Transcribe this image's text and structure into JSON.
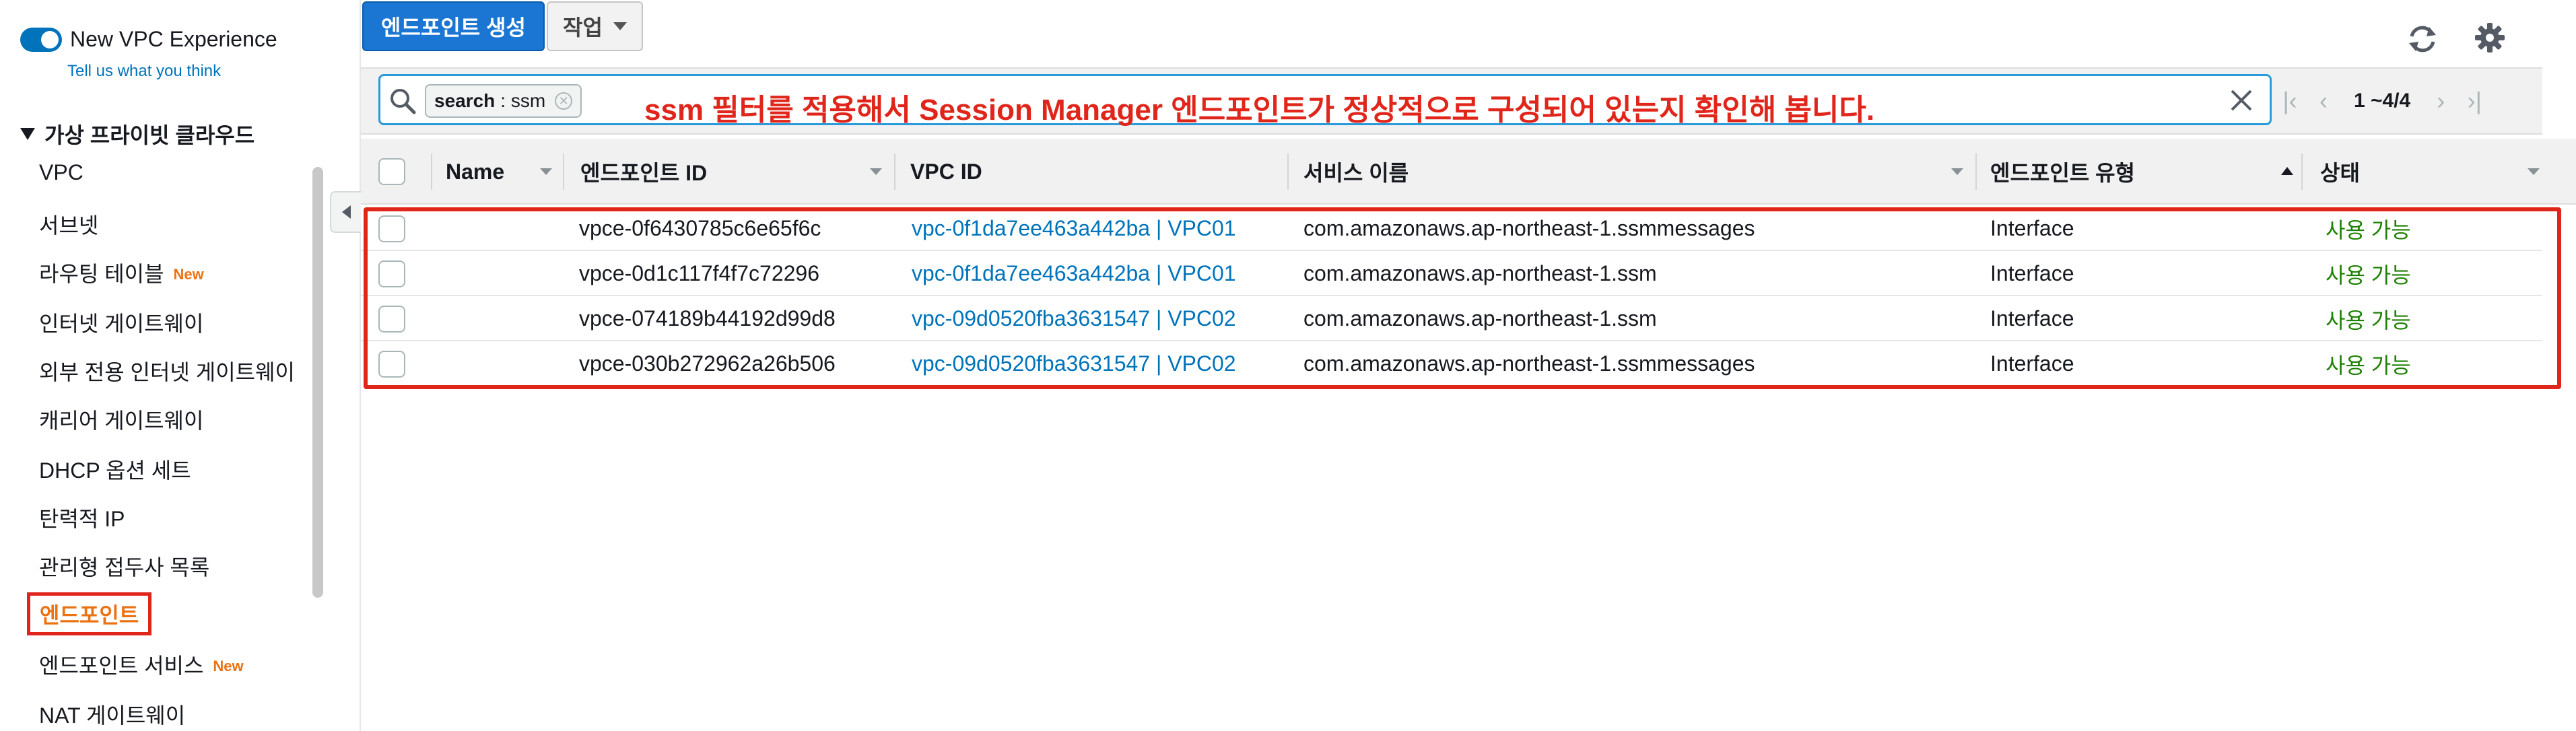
{
  "sidebar": {
    "toggle_label": "New VPC Experience",
    "feedback_link": "Tell us what you think",
    "section_title": "가상 프라이빗 클라우드",
    "items": [
      {
        "label": "VPC",
        "badge": ""
      },
      {
        "label": "서브넷",
        "badge": ""
      },
      {
        "label": "라우팅 테이블",
        "badge": "New"
      },
      {
        "label": "인터넷 게이트웨이",
        "badge": ""
      },
      {
        "label": "외부 전용 인터넷 게이트웨이",
        "badge": ""
      },
      {
        "label": "캐리어 게이트웨이",
        "badge": ""
      },
      {
        "label": "DHCP 옵션 세트",
        "badge": ""
      },
      {
        "label": "탄력적 IP",
        "badge": ""
      },
      {
        "label": "관리형 접두사 목록",
        "badge": ""
      },
      {
        "label": "엔드포인트",
        "badge": ""
      },
      {
        "label": "엔드포인트 서비스",
        "badge": "New"
      },
      {
        "label": "NAT 게이트웨이",
        "badge": ""
      }
    ],
    "active_item": "엔드포인트"
  },
  "toolbar": {
    "create_label": "엔드포인트 생성",
    "actions_label": "작업"
  },
  "filter": {
    "token_key": "search",
    "token_value": ": ssm",
    "annotation": "ssm 필터를 적용해서 Session Manager 엔드포인트가 정상적으로 구성되어 있는지 확인해 봅니다."
  },
  "pagination": {
    "range": "1 ~4/4"
  },
  "table": {
    "columns": {
      "name": "Name",
      "endpoint_id": "엔드포인트 ID",
      "vpc_id": "VPC ID",
      "service_name": "서비스 이름",
      "endpoint_type": "엔드포인트 유형",
      "status": "상태"
    },
    "rows": [
      {
        "name": "",
        "endpoint_id": "vpce-0f6430785c6e65f6c",
        "vpc_id": "vpc-0f1da7ee463a442ba | VPC01",
        "service_name": "com.amazonaws.ap-northeast-1.ssmmessages",
        "endpoint_type": "Interface",
        "status": "사용 가능"
      },
      {
        "name": "",
        "endpoint_id": "vpce-0d1c117f4f7c72296",
        "vpc_id": "vpc-0f1da7ee463a442ba | VPC01",
        "service_name": "com.amazonaws.ap-northeast-1.ssm",
        "endpoint_type": "Interface",
        "status": "사용 가능"
      },
      {
        "name": "",
        "endpoint_id": "vpce-074189b44192d99d8",
        "vpc_id": "vpc-09d0520fba3631547 | VPC02",
        "service_name": "com.amazonaws.ap-northeast-1.ssm",
        "endpoint_type": "Interface",
        "status": "사용 가능"
      },
      {
        "name": "",
        "endpoint_id": "vpce-030b272962a26b506",
        "vpc_id": "vpc-09d0520fba3631547 | VPC02",
        "service_name": "com.amazonaws.ap-northeast-1.ssmmessages",
        "endpoint_type": "Interface",
        "status": "사용 가능"
      }
    ]
  },
  "colors": {
    "primary_button": "#1a76d2",
    "link": "#0073bb",
    "status_available": "#1d8102",
    "highlight_red": "#e0251b",
    "badge_new": "#ec7211"
  }
}
